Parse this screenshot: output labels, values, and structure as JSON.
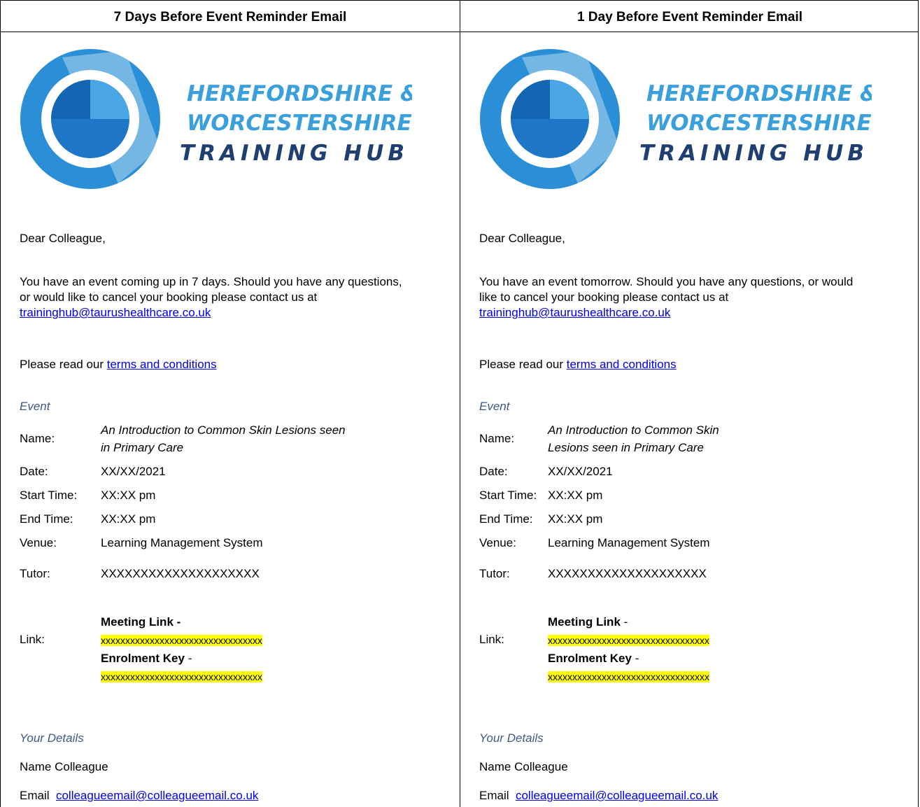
{
  "columns": [
    {
      "heading": "7 Days Before Event Reminder Email",
      "logo": {
        "line1": "HEREFORDSHIRE &",
        "line2": "WORCESTERSHIRE",
        "line3": "TRAINING HUB",
        "icon": "training-hub-ring-logo"
      },
      "greeting": "Dear Colleague,",
      "intro": "You have an event coming up in 7 days. Should you have any questions,",
      "intro2": "or would like to cancel your booking please contact us at",
      "email_link": "traininghub@taurushealthcare.co.uk",
      "terms_prefix": "Please read our ",
      "terms_link": "terms and conditions",
      "event_heading": "Event",
      "event": {
        "name_label": "Name:",
        "name_line1": "An Introduction to Common Skin Lesions seen",
        "name_line2": "in Primary Care",
        "date_label": "Date:",
        "date": "XX/XX/2021",
        "start_label": "Start Time:",
        "start": "XX:XX pm",
        "end_label": "End Time:",
        "end": "XX:XX pm",
        "venue_label": "Venue:",
        "venue": "Learning Management System",
        "tutor_label": "Tutor:",
        "tutor": "XXXXXXXXXXXXXXXXXXXX",
        "link_label": "Link:",
        "meeting_label": "Meeting Link -",
        "meeting_value": "xxxxxxxxxxxxxxxxxxxxxxxxxxxxxxxxx",
        "enrol_label": "Enrolment Key",
        "enrol_dash": " -",
        "enrol_value": "xxxxxxxxxxxxxxxxxxxxxxxxxxxxxxxxx"
      },
      "details_heading": "Your Details",
      "details": {
        "name_label": "Name",
        "name": "Colleague",
        "email_label": "Email",
        "email": "colleagueemail@colleagueemail.co.uk"
      }
    },
    {
      "heading": "1 Day Before Event Reminder Email",
      "logo": {
        "line1": "HEREFORDSHIRE &",
        "line2": "WORCESTERSHIRE",
        "line3": "TRAINING HUB",
        "icon": "training-hub-ring-logo"
      },
      "greeting": "Dear Colleague,",
      "intro": "You have an event tomorrow. Should you have any questions, or would",
      "intro2": "like to cancel your booking please contact us at",
      "email_link": "traininghub@taurushealthcare.co.uk",
      "terms_prefix": "Please read our ",
      "terms_link": "terms and conditions",
      "event_heading": "Event",
      "event": {
        "name_label": "Name:",
        "name_line1": "An Introduction to Common Skin",
        "name_line2": "Lesions seen in Primary Care",
        "date_label": "Date:",
        "date": "XX/XX/2021",
        "start_label": "Start Time:",
        "start": "XX:XX pm",
        "end_label": "End Time:",
        "end": "XX:XX pm",
        "venue_label": "Venue:",
        "venue": "Learning Management System",
        "tutor_label": "Tutor:",
        "tutor": "XXXXXXXXXXXXXXXXXXXX",
        "link_label": "Link:",
        "meeting_label": "Meeting Link",
        "meeting_dash": " -",
        "meeting_value": "xxxxxxxxxxxxxxxxxxxxxxxxxxxxxxxxx",
        "enrol_label": "Enrolment Key",
        "enrol_dash": " -",
        "enrol_value": "xxxxxxxxxxxxxxxxxxxxxxxxxxxxxxxxx"
      },
      "details_heading": "Your Details",
      "details": {
        "name_label": "Name",
        "name": "Colleague",
        "email_label": "Email",
        "email": "colleagueemail@colleagueemail.co.uk"
      }
    }
  ],
  "colors": {
    "logo_blue": "#2a8fd6",
    "logo_dark": "#1565b5",
    "logo_text": "#3aa0dc",
    "logo_text_dark": "#1f3f73",
    "highlight": "#ffff00",
    "section": "#3d5a80"
  }
}
